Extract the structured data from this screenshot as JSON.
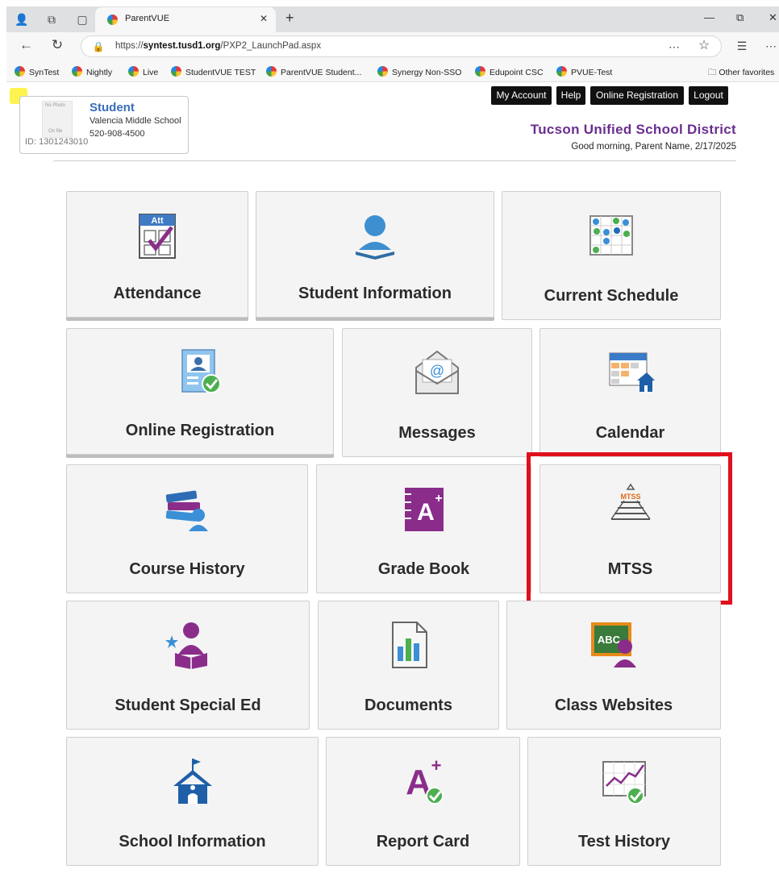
{
  "browser": {
    "tab_title": "ParentVUE",
    "url_prefix": "https://",
    "url_host": "syntest.tusd1.org",
    "url_path": "/PXP2_LaunchPad.aspx",
    "bookmarks": [
      "SynTest",
      "Nightly",
      "Live",
      "StudentVUE TEST",
      "ParentVUE Student...",
      "Synergy Non-SSO",
      "Edupoint CSC",
      "PVUE-Test"
    ],
    "other_favorites": "Other favorites"
  },
  "student": {
    "photo_top": "No Photo",
    "photo_bottom": "On file",
    "name": "Student",
    "school": "Valencia Middle School",
    "phone": "520-908-4500",
    "id": "ID: 1301243010"
  },
  "header": {
    "buttons": [
      "My Account",
      "Help",
      "Online Registration",
      "Logout"
    ],
    "district": "Tucson Unified School District",
    "greeting": "Good morning, Parent Name, 2/17/2025"
  },
  "tiles": [
    {
      "label": "Attendance",
      "icon": "attendance-icon"
    },
    {
      "label": "Student Information",
      "icon": "student-info-icon"
    },
    {
      "label": "Current Schedule",
      "icon": "schedule-icon"
    },
    {
      "label": "Online Registration",
      "icon": "registration-icon"
    },
    {
      "label": "Messages",
      "icon": "messages-icon"
    },
    {
      "label": "Calendar",
      "icon": "calendar-icon"
    },
    {
      "label": "Course History",
      "icon": "course-history-icon"
    },
    {
      "label": "Grade Book",
      "icon": "grade-book-icon"
    },
    {
      "label": "MTSS",
      "icon": "mtss-icon"
    },
    {
      "label": "Student Special Ed",
      "icon": "special-ed-icon"
    },
    {
      "label": "Documents",
      "icon": "documents-icon"
    },
    {
      "label": "Class Websites",
      "icon": "class-websites-icon"
    },
    {
      "label": "School Information",
      "icon": "school-info-icon"
    },
    {
      "label": "Report Card",
      "icon": "report-card-icon"
    },
    {
      "label": "Test History",
      "icon": "test-history-icon"
    }
  ],
  "icon_text": {
    "att": "Att",
    "at_sign": "@",
    "grade": "A",
    "grade_plus": "+",
    "mtss": "MTSS",
    "abc": "ABC",
    "report_a": "A",
    "report_plus": "+"
  },
  "colors": {
    "district": "#6a2e8f",
    "student_name": "#3a6db8",
    "highlight": "#e0101c",
    "tile_bg": "#f4f4f4"
  }
}
